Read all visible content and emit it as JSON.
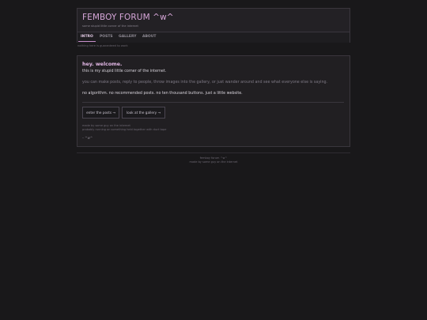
{
  "header": {
    "title": "FEMBOY FORUM ^w^",
    "tagline": "some stupid little corner of the internet"
  },
  "nav": {
    "items": [
      {
        "label": "INTRO",
        "active": true
      },
      {
        "label": "POSTS",
        "active": false
      },
      {
        "label": "GALLERY",
        "active": false
      },
      {
        "label": "ABOUT",
        "active": false
      }
    ]
  },
  "notice": "nothing here is guaranteed to work",
  "intro": {
    "greeting": "hey. welcome.",
    "p1": "this is my stupid little corner of the internet.",
    "p2": "you can make posts, reply to people, throw images into the gallery, or just wander around and see what everyone else is saying.",
    "p3": "no algorithm. no recommended posts. no ten thousand buttons. just a little website.",
    "buttons": {
      "posts": "enter the posts →",
      "gallery": "look at the gallery →"
    },
    "fine1": "made by some guy on the internet",
    "fine2": "probably running on something held together with duct tape",
    "sign": "– ^w^"
  },
  "footer": {
    "line1": "femboy forum ^w^",
    "line2": "made by some guy on the internet"
  },
  "colors": {
    "accent": "#d6a6d8",
    "background": "#19181a",
    "panel": "#211f22"
  }
}
